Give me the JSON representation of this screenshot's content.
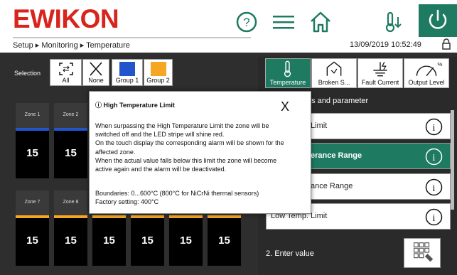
{
  "header": {
    "logo": "EWIKON",
    "breadcrumb": "Setup ▸ Monitoring ▸ Temperature",
    "datetime": "13/09/2019 10:52:49"
  },
  "selection": {
    "label": "Selection",
    "buttons": [
      {
        "label": "All"
      },
      {
        "label": "None"
      },
      {
        "label": "Group 1",
        "color": "#2255cc"
      },
      {
        "label": "Group 2",
        "color": "#f5a623"
      }
    ]
  },
  "zones": {
    "row1": [
      {
        "name": "Zone 1",
        "value": "15",
        "stripe": "#2255cc"
      },
      {
        "name": "Zone 2",
        "value": "15",
        "stripe": "#2255cc"
      }
    ],
    "row2": [
      {
        "name": "Zone 7",
        "value": "15",
        "stripe": "#f5a623"
      },
      {
        "name": "Zone 8",
        "value": "15",
        "stripe": "#f5a623"
      },
      {
        "value": "15",
        "stripe": "#f5a623"
      },
      {
        "value": "15",
        "stripe": "#f5a623"
      },
      {
        "value": "15",
        "stripe": "#f5a623"
      },
      {
        "value": "15",
        "stripe": "#f5a623"
      }
    ]
  },
  "tabs": [
    {
      "label": "Temperature",
      "active": true
    },
    {
      "label": "Broken S...",
      "active": false
    },
    {
      "label": "Fault Current",
      "active": false
    },
    {
      "label": "Output Level",
      "active": false
    }
  ],
  "params": {
    "title": "es and parameter",
    "rows": [
      {
        "label": "Limit",
        "active": false
      },
      {
        "label": "erance Range",
        "active": true
      },
      {
        "label": "ance Range",
        "active": false
      },
      {
        "label": "Low Temp. Limit",
        "active": false
      }
    ],
    "enter": "2. Enter value"
  },
  "modal": {
    "title": "ⓘ High Temperature Limit",
    "close": "X",
    "lines": [
      "When surpassing the High Temperature Limit the zone will be",
      "switched off and the LED stripe will shine red.",
      "On the touch display  the corresponding alarm will be shown for the",
      "affected zone.",
      "When the actual value falls below this limit the zone will become",
      "active again and the alarm will be deactivated."
    ],
    "boundaries": "Boundaries: 0...600°C (800°C for NiCrNi thermal sensors)",
    "factory": "Factory setting: 400°C"
  },
  "colors": {
    "brand_red": "#d9231d",
    "accent_green": "#1f7a62",
    "group1_blue": "#2255cc",
    "group2_orange": "#f5a623"
  }
}
